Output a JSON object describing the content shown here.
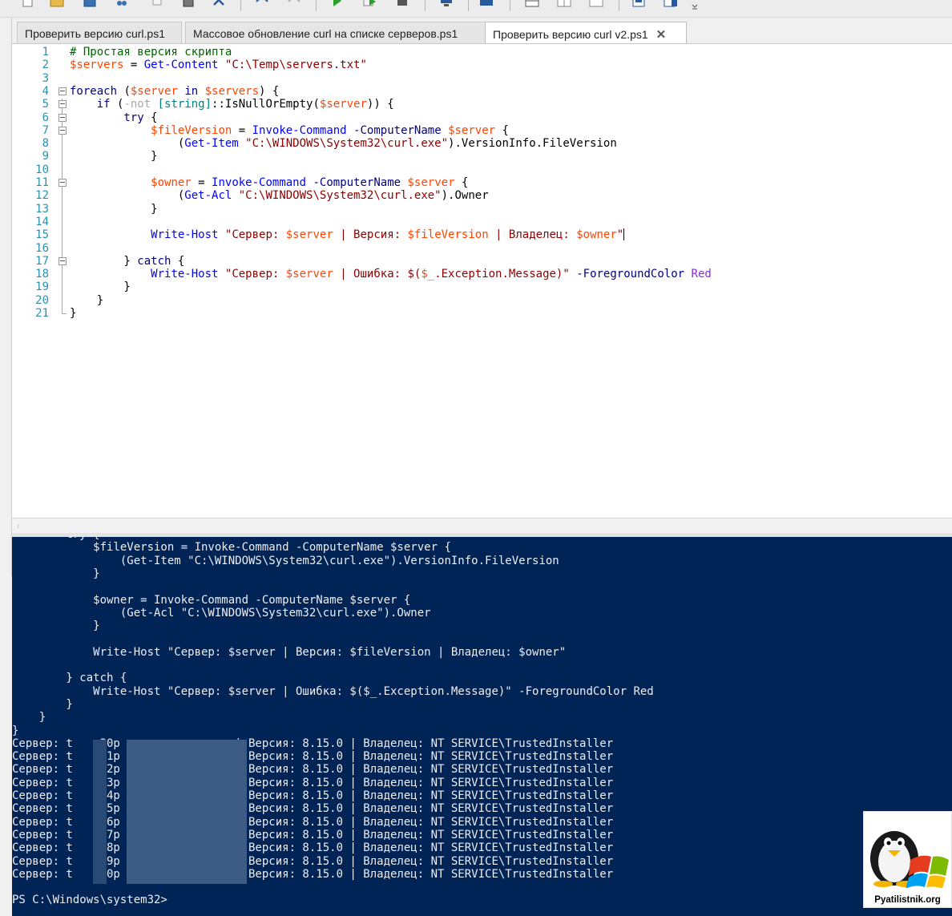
{
  "toolbar": {
    "icons": [
      "new-icon",
      "open-icon",
      "save-icon",
      "cut-icon",
      "copy-icon",
      "paste-icon",
      "clear-icon",
      "undo-icon",
      "redo-icon",
      "run-icon",
      "run-selection-icon",
      "stop-icon",
      "remote-icon",
      "console-icon",
      "layout-top-icon",
      "layout-right-icon",
      "layout-max-icon",
      "snippet-icon",
      "addon-icon",
      "more-icon"
    ]
  },
  "tabs": [
    {
      "label": "Проверить версию curl.ps1"
    },
    {
      "label": "Массовое обновление curl на списке серверов.ps1"
    },
    {
      "label": "Проверить версию curl v2.ps1",
      "close": "✕"
    }
  ],
  "editor": {
    "line_numbers": [
      "1",
      "2",
      "3",
      "4",
      "5",
      "6",
      "7",
      "8",
      "9",
      "10",
      "11",
      "12",
      "13",
      "14",
      "15",
      "16",
      "17",
      "18",
      "19",
      "20",
      "21"
    ],
    "t": {
      "l1": "# Простая версия скрипта",
      "l2a": "$servers",
      "l2b": " = ",
      "l2c": "Get-Content",
      "l2d": " ",
      "l2e": "\"C:\\Temp\\servers.txt\"",
      "l4a": "foreach",
      "l4b": " (",
      "l4c": "$server",
      "l4d": " in ",
      "l4e": "$servers",
      "l4f": ") {",
      "l5a": "    if",
      "l5b": " (",
      "l5c": "-not",
      "l5d": " ",
      "l5e": "[string]",
      "l5f": "::IsNullOrEmpty(",
      "l5g": "$server",
      "l5h": ")) {",
      "l6a": "        try",
      "l6b": " {",
      "l7a": "            ",
      "l7b": "$fileVersion",
      "l7c": " = ",
      "l7d": "Invoke-Command",
      "l7e": " ",
      "l7f": "-ComputerName",
      "l7g": " ",
      "l7h": "$server",
      "l7i": " {",
      "l8a": "                (",
      "l8b": "Get-Item",
      "l8c": " ",
      "l8d": "\"C:\\WINDOWS\\System32\\curl.exe\"",
      "l8e": ").VersionInfo.FileVersion",
      "l9": "            }",
      "l11a": "            ",
      "l11b": "$owner",
      "l11c": " = ",
      "l11d": "Invoke-Command",
      "l11e": " ",
      "l11f": "-ComputerName",
      "l11g": " ",
      "l11h": "$server",
      "l11i": " {",
      "l12a": "                (",
      "l12b": "Get-Acl",
      "l12c": " ",
      "l12d": "\"C:\\WINDOWS\\System32\\curl.exe\"",
      "l12e": ").Owner",
      "l13": "            }",
      "l15a": "            ",
      "l15b": "Write-Host",
      "l15c": " ",
      "l15d": "\"Сервер: ",
      "l15e": "$server",
      "l15f": " | Версия: ",
      "l15g": "$fileVersion",
      "l15h": " | Владелец: ",
      "l15i": "$owner",
      "l15j": "\"",
      "l17a": "        } ",
      "l17b": "catch",
      "l17c": " {",
      "l18a": "            ",
      "l18b": "Write-Host",
      "l18c": " ",
      "l18d": "\"Сервер: ",
      "l18e": "$server",
      "l18f": " | Ошибка: $(",
      "l18g": "$_",
      "l18h": ".Exception.Message)\"",
      "l18i": " ",
      "l18j": "-ForegroundColor",
      "l18k": " ",
      "l18l": "Red",
      "l19": "        }",
      "l20": "    }",
      "l21": "}"
    }
  },
  "console": {
    "lines": [
      "        try {",
      "            $fileVersion = Invoke-Command -ComputerName $server {",
      "                (Get-Item \"C:\\WINDOWS\\System32\\curl.exe\").VersionInfo.FileVersion",
      "            }",
      "",
      "            $owner = Invoke-Command -ComputerName $server {",
      "                (Get-Acl \"C:\\WINDOWS\\System32\\curl.exe\").Owner",
      "            }",
      "",
      "            Write-Host \"Сервер: $server | Версия: $fileVersion | Владелец: $owner\"",
      "",
      "        } catch {",
      "            Write-Host \"Сервер: $server | Ошибка: $($_.Exception.Message)\" -ForegroundColor Red",
      "        }",
      "    }",
      "}",
      "Сервер: t   m30p                 | Версия: 8.15.0 | Владелец: NT SERVICE\\TrustedInstaller",
      "Сервер: t   m31p                 | Версия: 8.15.0 | Владелец: NT SERVICE\\TrustedInstaller",
      "Сервер: t   m32p                 | Версия: 8.15.0 | Владелец: NT SERVICE\\TrustedInstaller",
      "Сервер: t   m33p                 | Версия: 8.15.0 | Владелец: NT SERVICE\\TrustedInstaller",
      "Сервер: t   m34p                 | Версия: 8.15.0 | Владелец: NT SERVICE\\TrustedInstaller",
      "Сервер: t   m35p                 | Версия: 8.15.0 | Владелец: NT SERVICE\\TrustedInstaller",
      "Сервер: t   m36p                 | Версия: 8.15.0 | Владелец: NT SERVICE\\TrustedInstaller",
      "Сервер: t   m37p                 | Версия: 8.15.0 | Владелец: NT SERVICE\\TrustedInstaller",
      "Сервер: t   m38p                 | Версия: 8.15.0 | Владелец: NT SERVICE\\TrustedInstaller",
      "Сервер: t   m39p                 | Версия: 8.15.0 | Владелец: NT SERVICE\\TrustedInstaller",
      "Сервер: t   m40p                 | Версия: 8.15.0 | Владелец: NT SERVICE\\TrustedInstaller",
      "",
      "PS C:\\Windows\\system32>"
    ]
  },
  "logo": {
    "text": "Pyatilistnik.org"
  },
  "colors": {
    "console_bg": "#012456",
    "comment": "#006400",
    "variable": "#ff4500",
    "command": "#0000ff",
    "string": "#8b0000",
    "keyword": "#00008b"
  }
}
